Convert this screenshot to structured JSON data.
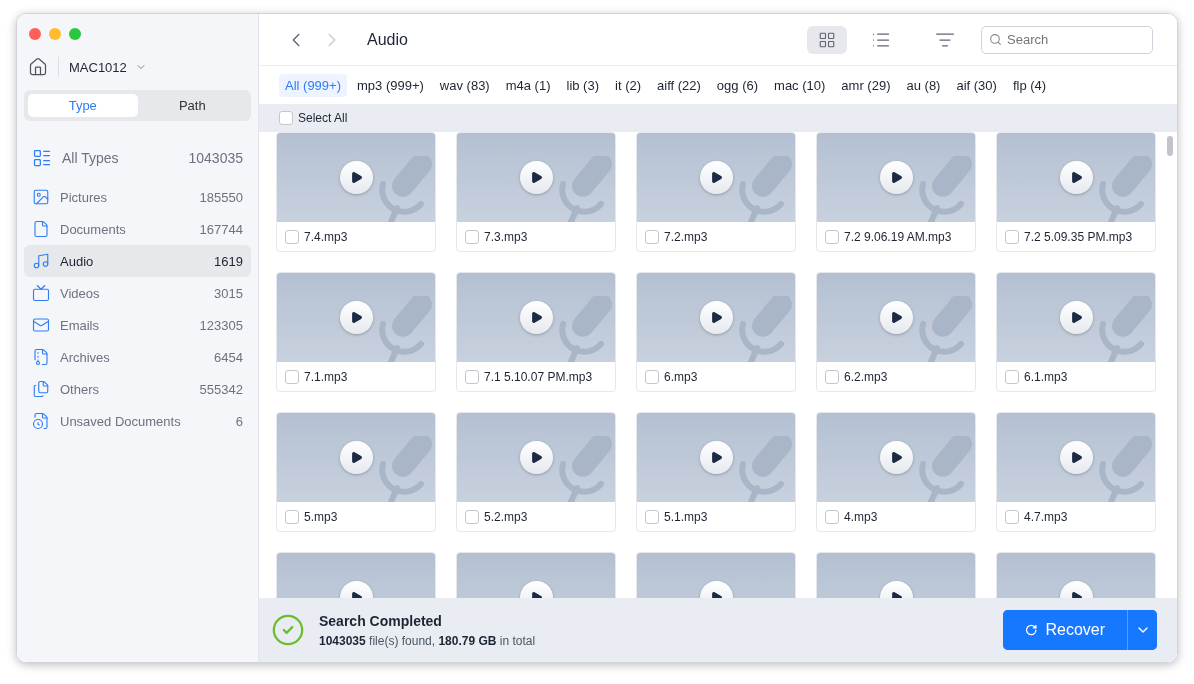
{
  "sidebar": {
    "drive": "MAC1012",
    "segments": [
      {
        "label": "Type",
        "selected": true
      },
      {
        "label": "Path",
        "selected": false
      }
    ],
    "all_types": {
      "label": "All Types",
      "count": "1043035"
    },
    "items": [
      {
        "label": "Pictures",
        "count": "185550",
        "selected": false
      },
      {
        "label": "Documents",
        "count": "167744",
        "selected": false
      },
      {
        "label": "Audio",
        "count": "1619",
        "selected": true
      },
      {
        "label": "Videos",
        "count": "3015",
        "selected": false
      },
      {
        "label": "Emails",
        "count": "123305",
        "selected": false
      },
      {
        "label": "Archives",
        "count": "6454",
        "selected": false
      },
      {
        "label": "Others",
        "count": "555342",
        "selected": false
      },
      {
        "label": "Unsaved Documents",
        "count": "6",
        "selected": false
      }
    ]
  },
  "toolbar": {
    "title": "Audio",
    "back_disabled": false,
    "forward_disabled": true,
    "view_buttons": [
      {
        "selected": true
      },
      {
        "selected": false
      }
    ],
    "search": {
      "placeholder": "Search"
    }
  },
  "filters": [
    {
      "label": "All (999+)",
      "selected": true
    },
    {
      "label": "mp3 (999+)",
      "selected": false
    },
    {
      "label": "wav (83)",
      "selected": false
    },
    {
      "label": "m4a (1)",
      "selected": false
    },
    {
      "label": "lib (3)",
      "selected": false
    },
    {
      "label": "it (2)",
      "selected": false
    },
    {
      "label": "aiff (22)",
      "selected": false
    },
    {
      "label": "ogg (6)",
      "selected": false
    },
    {
      "label": "mac (10)",
      "selected": false
    },
    {
      "label": "amr (29)",
      "selected": false
    },
    {
      "label": "au (8)",
      "selected": false
    },
    {
      "label": "aif (30)",
      "selected": false
    },
    {
      "label": "flp (4)",
      "selected": false
    }
  ],
  "select_all": {
    "label": "Select All",
    "checked": false
  },
  "files": [
    {
      "kind": "full",
      "name": "7.4.mp3",
      "checked": false
    },
    {
      "kind": "full",
      "name": "7.3.mp3",
      "checked": false
    },
    {
      "kind": "full",
      "name": "7.2.mp3",
      "checked": false
    },
    {
      "kind": "full",
      "name": "7.2 9.06.19 AM.mp3",
      "checked": false
    },
    {
      "kind": "full",
      "name": "7.2 5.09.35 PM.mp3",
      "checked": false
    },
    {
      "kind": "full",
      "name": "7.1.mp3",
      "checked": false
    },
    {
      "kind": "full",
      "name": "7.1 5.10.07 PM.mp3",
      "checked": false
    },
    {
      "kind": "full",
      "name": "6.mp3",
      "checked": false
    },
    {
      "kind": "full",
      "name": "6.2.mp3",
      "checked": false
    },
    {
      "kind": "full",
      "name": "6.1.mp3",
      "checked": false
    },
    {
      "kind": "full",
      "name": "5.mp3",
      "checked": false
    },
    {
      "kind": "full",
      "name": "5.2.mp3",
      "checked": false
    },
    {
      "kind": "full",
      "name": "5.1.mp3",
      "checked": false
    },
    {
      "kind": "full",
      "name": "4.mp3",
      "checked": false
    },
    {
      "kind": "full",
      "name": "4.7.mp3",
      "checked": false
    },
    {
      "kind": "cut"
    },
    {
      "kind": "cut"
    },
    {
      "kind": "cut"
    },
    {
      "kind": "cut"
    },
    {
      "kind": "cut"
    }
  ],
  "status": {
    "title": "Search Completed",
    "detail": "**1043035** file(s) found, **180.79 GB** in total"
  },
  "recover_button": {
    "label": "Recover"
  }
}
